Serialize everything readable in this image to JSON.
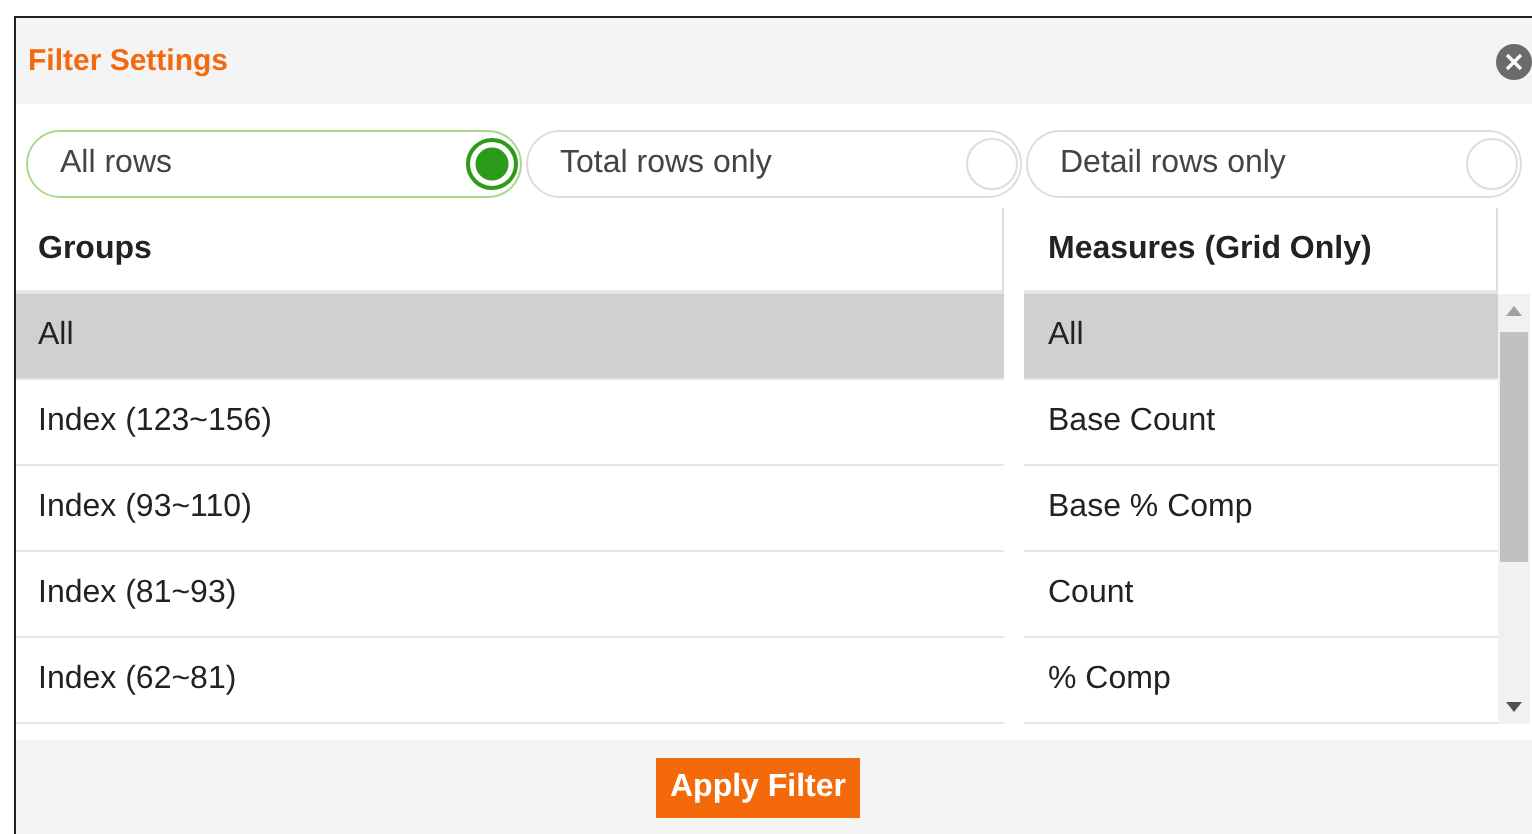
{
  "dialog": {
    "title": "Filter Settings"
  },
  "row_filter": [
    {
      "label": "All rows",
      "selected": true
    },
    {
      "label": "Total rows only",
      "selected": false
    },
    {
      "label": "Detail rows only",
      "selected": false
    }
  ],
  "groups": {
    "heading": "Groups",
    "items": [
      {
        "label": "All",
        "selected": true
      },
      {
        "label": "Index (123~156)",
        "selected": false
      },
      {
        "label": "Index (93~110)",
        "selected": false
      },
      {
        "label": "Index (81~93)",
        "selected": false
      },
      {
        "label": "Index (62~81)",
        "selected": false
      }
    ]
  },
  "measures": {
    "heading": "Measures (Grid Only)",
    "items": [
      {
        "label": "All",
        "selected": true
      },
      {
        "label": "Base Count",
        "selected": false
      },
      {
        "label": "Base % Comp",
        "selected": false
      },
      {
        "label": "Count",
        "selected": false
      },
      {
        "label": "% Comp",
        "selected": false
      }
    ]
  },
  "apply_button": "Apply Filter"
}
